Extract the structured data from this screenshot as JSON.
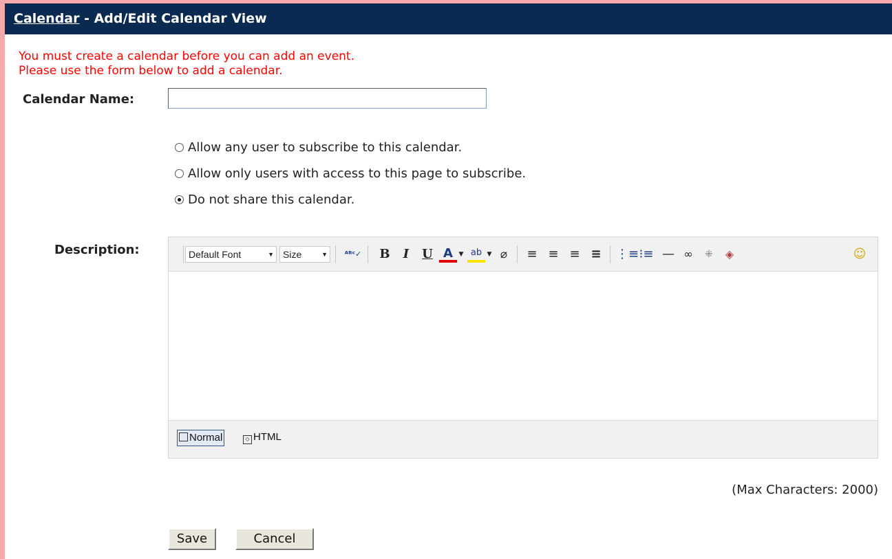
{
  "header": {
    "link": "Calendar",
    "title": " - Add/Edit Calendar View"
  },
  "error": {
    "line1": "You must create a calendar before you can add an event.",
    "line2": "Please use the form below to add a calendar."
  },
  "form": {
    "name_label": "Calendar Name:",
    "name_value": "",
    "sharing": [
      {
        "label": "Allow any user to subscribe to this calendar.",
        "checked": false
      },
      {
        "label": "Allow only users with access to this page to subscribe.",
        "checked": false
      },
      {
        "label": "Do not share this calendar.",
        "checked": true
      }
    ],
    "description_label": "Description:"
  },
  "editor": {
    "font_select": "Default Font",
    "size_select": "Size",
    "icons": [
      "spellcheck-icon",
      "bold-icon",
      "italic-icon",
      "underline-icon",
      "font-color-icon",
      "highlight-icon",
      "eraser-icon",
      "align-left-icon",
      "align-center-icon",
      "align-right-icon",
      "justify-icon",
      "ordered-list-icon",
      "unordered-list-icon",
      "horizontal-rule-icon",
      "link-icon",
      "unlink-icon",
      "image-icon",
      "smiley-icon"
    ],
    "modes": {
      "normal": "Normal",
      "html": "HTML"
    }
  },
  "max_chars": "(Max Characters: 2000)",
  "buttons": {
    "save": "Save",
    "cancel": "Cancel"
  },
  "colors": {
    "header_bg": "#0b2a52",
    "error": "#ff0000",
    "frame": "#f4a9a9"
  }
}
